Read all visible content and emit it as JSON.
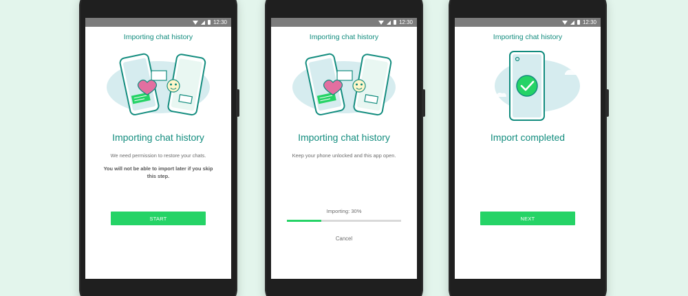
{
  "status_bar": {
    "time": "12:30"
  },
  "screens": [
    {
      "header": "Importing chat history",
      "title": "Importing chat history",
      "description": "We need permission to restore your chats.",
      "warning": "You will not be able to import later if you skip this step.",
      "button_label": "START"
    },
    {
      "header": "Importing chat history",
      "title": "Importing chat history",
      "description": "Keep your phone unlocked and this app open.",
      "progress_text": "Importing: 30%",
      "progress_fraction": 0.3,
      "cancel_label": "Cancel"
    },
    {
      "header": "Importing chat history",
      "title": "Import completed",
      "button_label": "NEXT"
    }
  ],
  "colors": {
    "accent": "#128c7e",
    "button": "#25d366",
    "background": "#e3f5ec",
    "illustration_bg": "#d6ecef",
    "heart": "#e36fa0"
  },
  "icons": [
    "wifi-icon",
    "signal-icon",
    "battery-icon",
    "heart-icon",
    "emoji-icon",
    "checkmark-icon"
  ]
}
